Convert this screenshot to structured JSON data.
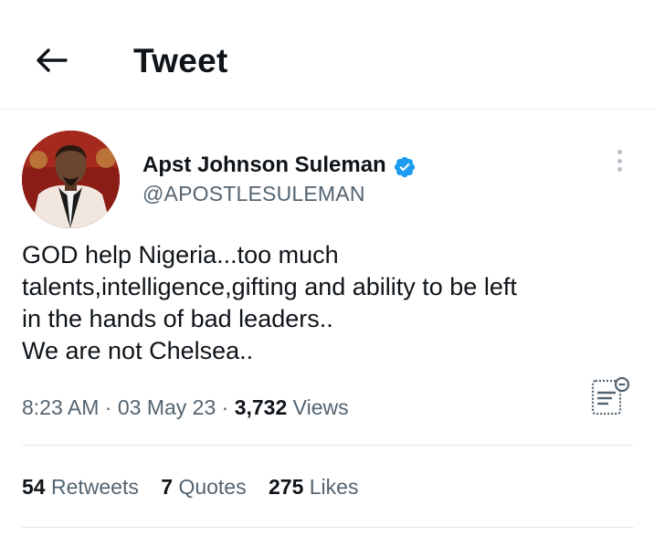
{
  "header": {
    "title": "Tweet",
    "back_icon": "arrow-left-icon"
  },
  "author": {
    "name": "Apst Johnson Suleman",
    "handle": "@APOSTLESULEMAN",
    "verified": true,
    "verified_color": "#1d9bf0"
  },
  "tweet": {
    "lines": [
      "GOD help Nigeria...too much",
      "talents,intelligence,gifting and ability to be left",
      "in the hands of bad leaders..",
      "We are not Chelsea.."
    ]
  },
  "meta": {
    "time": "8:23 AM",
    "date": "03 May 23",
    "separator": "·",
    "views_count": "3,732",
    "views_label": "Views"
  },
  "stats": {
    "retweets_count": "54",
    "retweets_label": "Retweets",
    "quotes_count": "7",
    "quotes_label": "Quotes",
    "likes_count": "275",
    "likes_label": "Likes"
  },
  "colors": {
    "text_primary": "#0f1419",
    "text_secondary": "#536471",
    "divider": "#e6e9eb"
  }
}
